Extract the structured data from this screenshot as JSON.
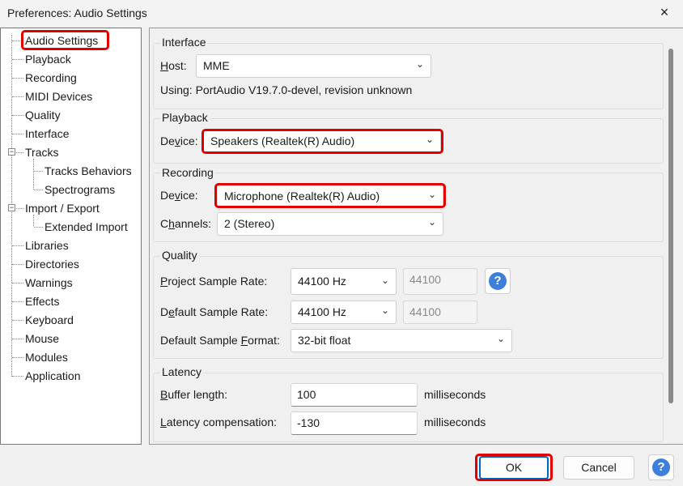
{
  "window": {
    "title": "Preferences: Audio Settings",
    "close_icon": "×"
  },
  "tree": {
    "items": [
      "Audio Settings",
      "Playback",
      "Recording",
      "MIDI Devices",
      "Quality",
      "Interface",
      "Tracks",
      "Tracks Behaviors",
      "Spectrograms",
      "Import / Export",
      "Extended Import",
      "Libraries",
      "Directories",
      "Warnings",
      "Effects",
      "Keyboard",
      "Mouse",
      "Modules",
      "Application"
    ],
    "selected": "Audio Settings"
  },
  "interface": {
    "title": "Interface",
    "host_label": "Host:",
    "host_value": "MME",
    "using_text": "Using: PortAudio V19.7.0-devel, revision unknown"
  },
  "playback": {
    "title": "Playback",
    "device_label": "Device:",
    "device_value": "Speakers (Realtek(R) Audio)"
  },
  "recording": {
    "title": "Recording",
    "device_label": "Device:",
    "device_value": "Microphone (Realtek(R) Audio)",
    "channels_label": "Channels:",
    "channels_value": "2 (Stereo)"
  },
  "quality": {
    "title": "Quality",
    "project_rate_label": "Project Sample Rate:",
    "project_rate_value": "44100 Hz",
    "project_rate_custom": "44100",
    "default_rate_label": "Default Sample Rate:",
    "default_rate_value": "44100 Hz",
    "default_rate_custom": "44100",
    "format_label": "Default Sample Format:",
    "format_value": "32-bit float"
  },
  "latency": {
    "title": "Latency",
    "buffer_label": "Buffer length:",
    "buffer_value": "100",
    "buffer_unit": "milliseconds",
    "compensation_label": "Latency compensation:",
    "compensation_value": "-130",
    "compensation_unit": "milliseconds"
  },
  "buttons": {
    "ok": "OK",
    "cancel": "Cancel",
    "help_glyph": "?"
  },
  "colors": {
    "highlight": "#e00000",
    "accent": "#0067c0",
    "help": "#3f7fdc"
  }
}
